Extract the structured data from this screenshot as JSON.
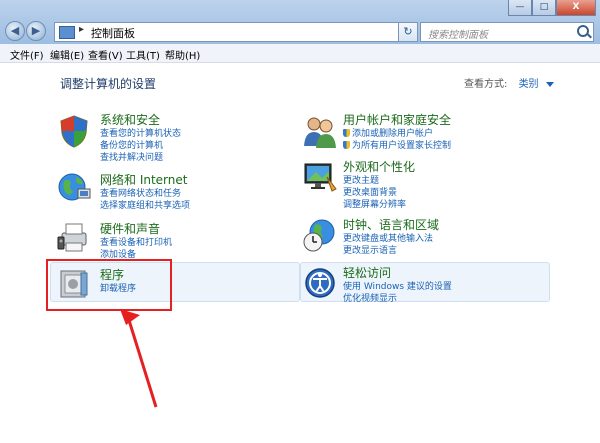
{
  "window": {
    "address": "控制面板",
    "search_placeholder": "搜索控制面板",
    "buttons": {
      "minimize": "—",
      "maximize": "□",
      "close": "X"
    }
  },
  "menu": [
    "文件(F)",
    "编辑(E)",
    "查看(V)",
    "工具(T)",
    "帮助(H)"
  ],
  "content": {
    "heading": "调整计算机的设置",
    "view_by_label": "查看方式:",
    "view_by_value": "类别"
  },
  "categories": {
    "system": {
      "title": "系统和安全",
      "links": [
        "查看您的计算机状态",
        "备份您的计算机",
        "查找并解决问题"
      ]
    },
    "network": {
      "title": "网络和 Internet",
      "links": [
        "查看网络状态和任务",
        "选择家庭组和共享选项"
      ]
    },
    "hardware": {
      "title": "硬件和声音",
      "links": [
        "查看设备和打印机",
        "添加设备"
      ]
    },
    "programs": {
      "title": "程序",
      "links": [
        "卸载程序"
      ]
    },
    "users": {
      "title": "用户帐户和家庭安全",
      "links": [
        "添加或删除用户帐户",
        "为所有用户设置家长控制"
      ]
    },
    "appearance": {
      "title": "外观和个性化",
      "links": [
        "更改主题",
        "更改桌面背景",
        "调整屏幕分辨率"
      ]
    },
    "clock": {
      "title": "时钟、语言和区域",
      "links": [
        "更改键盘或其他输入法",
        "更改显示语言"
      ]
    },
    "access": {
      "title": "轻松访问",
      "links": [
        "使用 Windows 建议的设置",
        "优化视频显示"
      ]
    }
  },
  "colors": {
    "annotation": "#e62020",
    "link": "#1a62b5",
    "title": "#1b6b1b"
  }
}
